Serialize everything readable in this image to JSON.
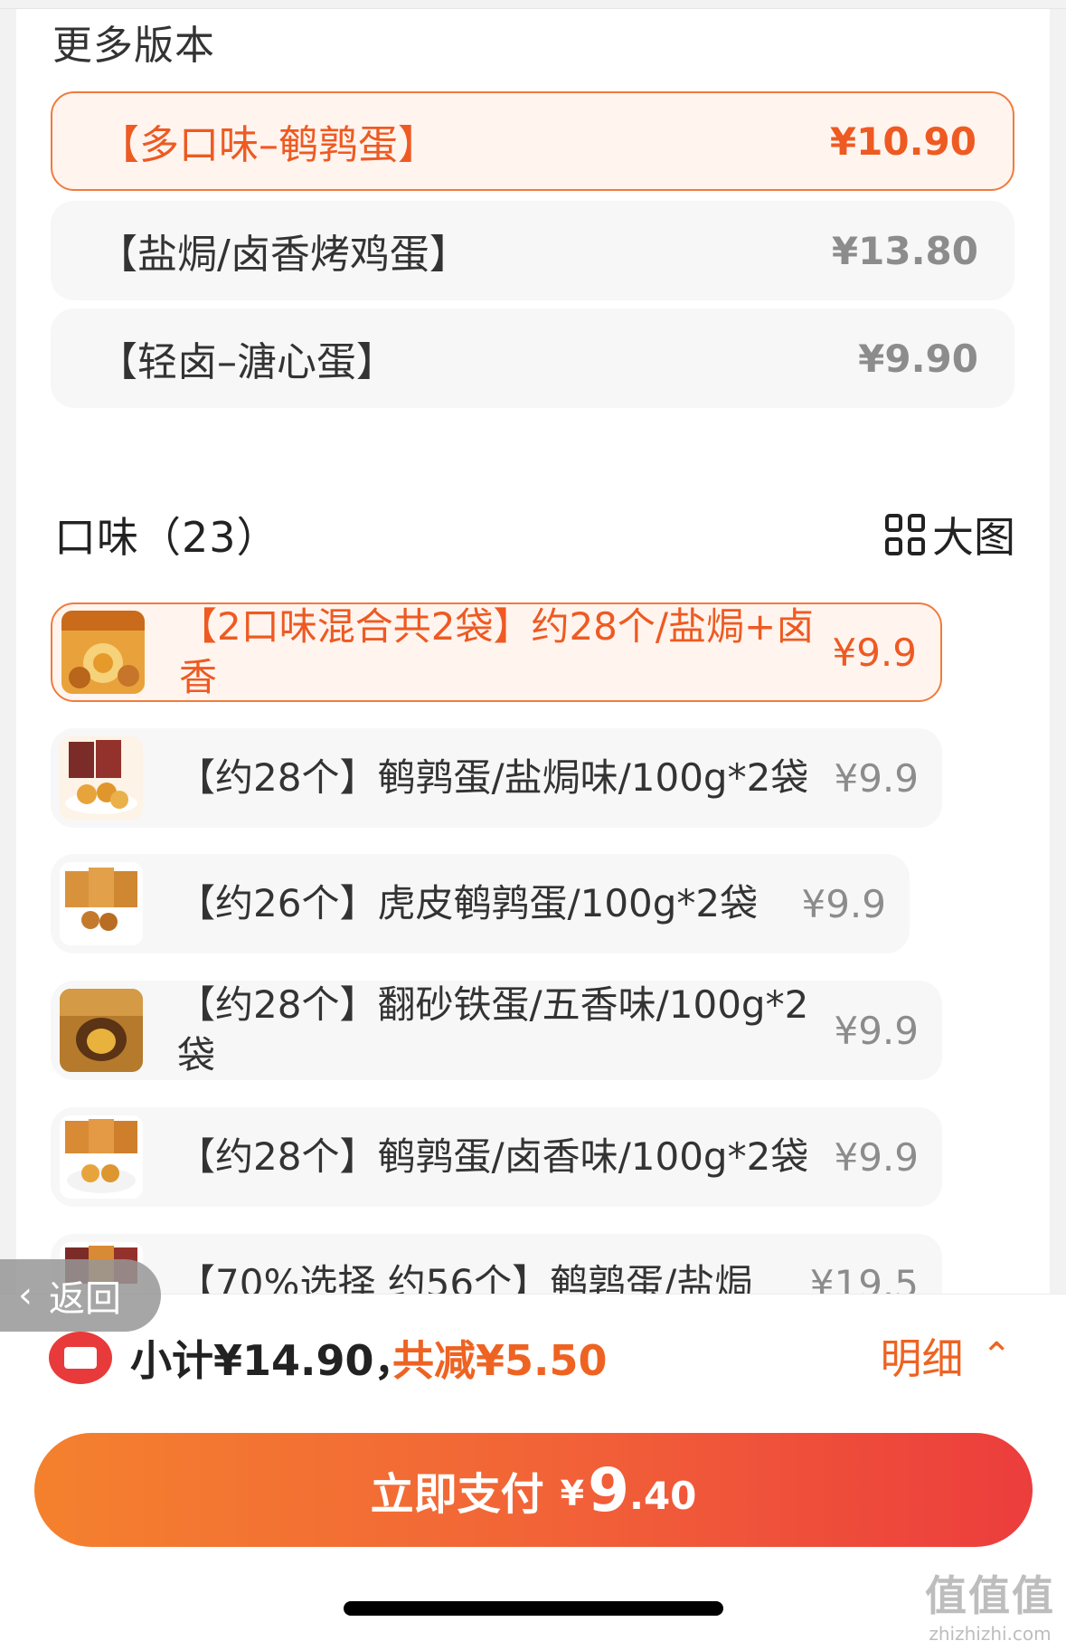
{
  "versions": {
    "title": "更多版本",
    "items": [
      {
        "name": "【多口味–鹌鹑蛋】",
        "price": "¥10.90",
        "selected": true
      },
      {
        "name": "【盐焗/卤香烤鸡蛋】",
        "price": "¥13.80",
        "selected": false
      },
      {
        "name": "【轻卤–溏心蛋】",
        "price": "¥9.90",
        "selected": false
      }
    ]
  },
  "flavors": {
    "title": "口味（23）",
    "big_view_label": "大图",
    "big_view_icon": "grid-icon",
    "items": [
      {
        "name": "【2口味混合共2袋】约28个/盐焗+卤香",
        "price": "¥9.9",
        "selected": true
      },
      {
        "name": "【约28个】鹌鹑蛋/盐焗味/100g*2袋",
        "price": "¥9.9",
        "selected": false
      },
      {
        "name": "【约26个】虎皮鹌鹑蛋/100g*2袋",
        "price": "¥9.9",
        "selected": false
      },
      {
        "name": "【约28个】翻砂铁蛋/五香味/100g*2袋",
        "price": "¥9.9",
        "selected": false
      },
      {
        "name": "【约28个】鹌鹑蛋/卤香味/100g*2袋",
        "price": "¥9.9",
        "selected": false
      },
      {
        "name": "【70%选择 约56个】鹌鹑蛋/盐焗",
        "price": "¥19.5",
        "selected": false
      }
    ]
  },
  "back": {
    "label": "返回",
    "icon": "chevron-left-icon"
  },
  "summary": {
    "coupon_icon": "coupon-icon",
    "subtotal": "小计¥14.90，",
    "discount": "共减¥5.50",
    "detail_label": "明细",
    "detail_icon": "chevron-up-icon"
  },
  "pay": {
    "label": "立即支付",
    "currency": "¥",
    "amount_int": "9",
    "amount_dec": ".40"
  },
  "watermark": {
    "logo": "值值值",
    "site": "zhizhizhi.com"
  },
  "colors": {
    "accent": "#ee5a22",
    "selected_bg": "#fff4ee",
    "pay_gradient_start": "#f4812e",
    "pay_gradient_end": "#ec3d3d"
  }
}
